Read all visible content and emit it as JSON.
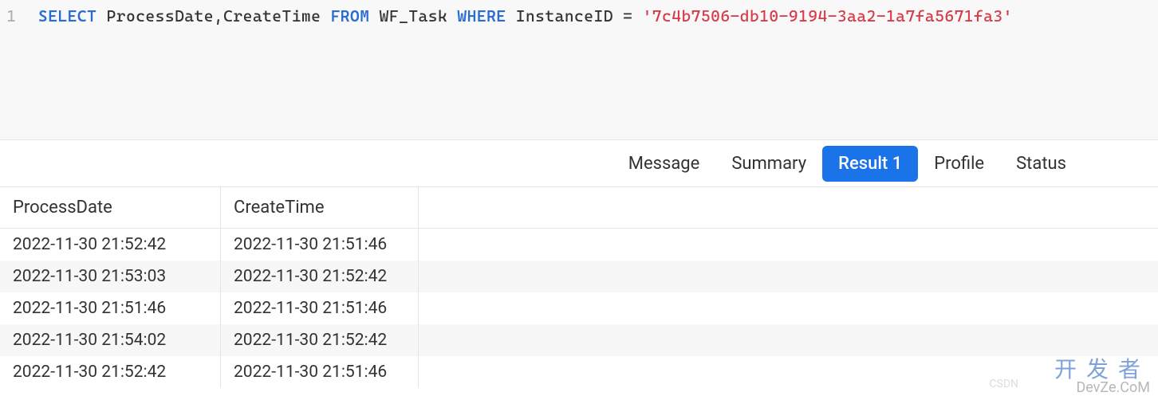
{
  "editor": {
    "line_number": "1",
    "sql": {
      "select_kw": "SELECT",
      "cols": "ProcessDate,CreateTime",
      "from_kw": "FROM",
      "table": "WF_Task",
      "where_kw": "WHERE",
      "condition_col": "InstanceID",
      "eq": "=",
      "value": "'7c4b7506-db10-9194-3aa2-1a7fa5671fa3'"
    }
  },
  "tabs": {
    "message": "Message",
    "summary": "Summary",
    "result1": "Result 1",
    "profile": "Profile",
    "status": "Status"
  },
  "table": {
    "headers": {
      "col1": "ProcessDate",
      "col2": "CreateTime"
    },
    "rows": [
      {
        "c1": "2022-11-30 21:52:42",
        "c2": "2022-11-30 21:51:46"
      },
      {
        "c1": "2022-11-30 21:53:03",
        "c2": "2022-11-30 21:52:42"
      },
      {
        "c1": "2022-11-30 21:51:46",
        "c2": "2022-11-30 21:51:46"
      },
      {
        "c1": "2022-11-30 21:54:02",
        "c2": "2022-11-30 21:52:42"
      },
      {
        "c1": "2022-11-30 21:52:42",
        "c2": "2022-11-30 21:51:46"
      }
    ]
  },
  "watermark": {
    "cn": "开发者",
    "en": "DevZe.CoM",
    "csdn": "CSDN"
  }
}
